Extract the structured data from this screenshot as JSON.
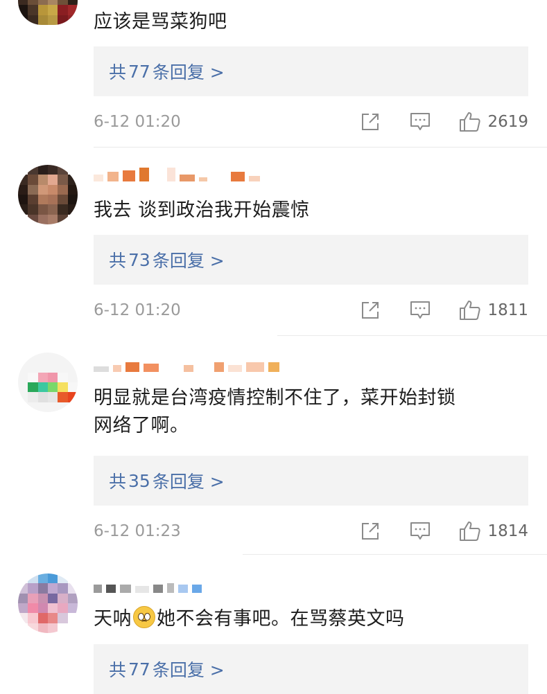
{
  "comments": [
    {
      "text": "应该是骂菜狗吧",
      "replies": {
        "prefix": "共",
        "count": "77",
        "suffix": "条回复 >"
      },
      "time": "6-12 01:20",
      "likes": "2619"
    },
    {
      "text": "我去 谈到政治我开始震惊",
      "replies": {
        "prefix": "共",
        "count": "73",
        "suffix": "条回复 >"
      },
      "time": "6-12 01:20",
      "likes": "1811"
    },
    {
      "text_line1": "明显就是台湾疫情控制不住了，菜开始封锁",
      "text_line2": "网络了啊。",
      "replies": {
        "prefix": "共",
        "count": "35",
        "suffix": "条回复 >"
      },
      "time": "6-12 01:23",
      "likes": "1814"
    },
    {
      "text_before": "天呐",
      "emoji": "pleading-face-emoji",
      "text_after": "她不会有事吧。在骂蔡英文吗",
      "replies": {
        "prefix": "共",
        "count": "77",
        "suffix": "条回复 >"
      }
    }
  ],
  "icons": {
    "share": "share-icon",
    "comment": "comment-icon",
    "like": "thumbs-up-icon"
  },
  "colors": {
    "reply_link": "#4a6fa8",
    "reply_bg": "#f3f3f3",
    "meta_text": "#9a9a9a",
    "icon_stroke": "#8a8a8a"
  }
}
